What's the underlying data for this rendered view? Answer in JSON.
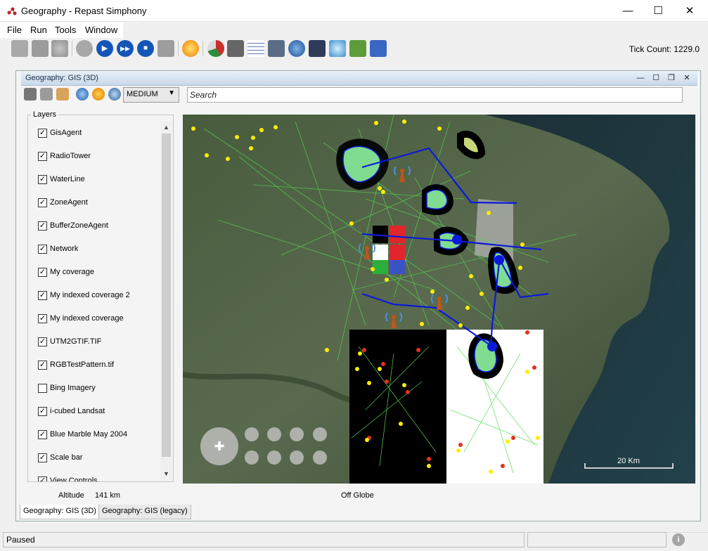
{
  "window": {
    "title": "Geography - Repast Simphony",
    "minimize_glyph": "—",
    "maximize_glyph": "☐",
    "close_glyph": "✕"
  },
  "menu": {
    "items": [
      "File",
      "Run",
      "Tools",
      "Window"
    ]
  },
  "toolbar": {
    "tick_count": "Tick Count: 1229.0",
    "icons": [
      "load-icon",
      "save-icon",
      "database-icon",
      "power-icon",
      "step-icon",
      "play-icon",
      "stop-icon",
      "reset-icon",
      "lightning-icon",
      "chart-icon",
      "save-disk-icon",
      "grid-icon",
      "calculator-icon",
      "globe-user-icon",
      "binoculars-icon",
      "magnifier-icon",
      "display-icon",
      "users-icon"
    ]
  },
  "frame": {
    "title": "Geography: GIS (3D)"
  },
  "gis_toolbar": {
    "detail_level": "MEDIUM",
    "search_placeholder": "Search"
  },
  "layers": {
    "title": "Layers",
    "items": [
      {
        "label": "GisAgent",
        "checked": true
      },
      {
        "label": "RadioTower",
        "checked": true
      },
      {
        "label": "WaterLine",
        "checked": true
      },
      {
        "label": "ZoneAgent",
        "checked": true
      },
      {
        "label": "BufferZoneAgent",
        "checked": true
      },
      {
        "label": "Network",
        "checked": true
      },
      {
        "label": "My coverage",
        "checked": true
      },
      {
        "label": "My indexed coverage 2",
        "checked": true
      },
      {
        "label": "My indexed coverage",
        "checked": true
      },
      {
        "label": "UTM2GTIF.TIF",
        "checked": true
      },
      {
        "label": "RGBTestPattern.tif",
        "checked": true
      },
      {
        "label": "Bing Imagery",
        "checked": false
      },
      {
        "label": "i-cubed Landsat",
        "checked": true
      },
      {
        "label": "Blue Marble May 2004",
        "checked": true
      },
      {
        "label": "Scale bar",
        "checked": true
      },
      {
        "label": "View Controls",
        "checked": true
      }
    ]
  },
  "map": {
    "scale_label": "20 Km",
    "altitude_label": "Altitude",
    "altitude_value": "141 km",
    "globe_status": "Off Globe"
  },
  "tabs": [
    "Geography: GIS (3D)",
    "Geography: GIS (legacy)"
  ],
  "status": {
    "text": "Paused",
    "info_glyph": "i"
  },
  "colors": {
    "network_line": "#0a1ad8",
    "agent_point": "#ffee00",
    "link_line": "#55dd55",
    "zone_fill": "#7fdc90",
    "buffer_fill": "#c9d77a"
  }
}
